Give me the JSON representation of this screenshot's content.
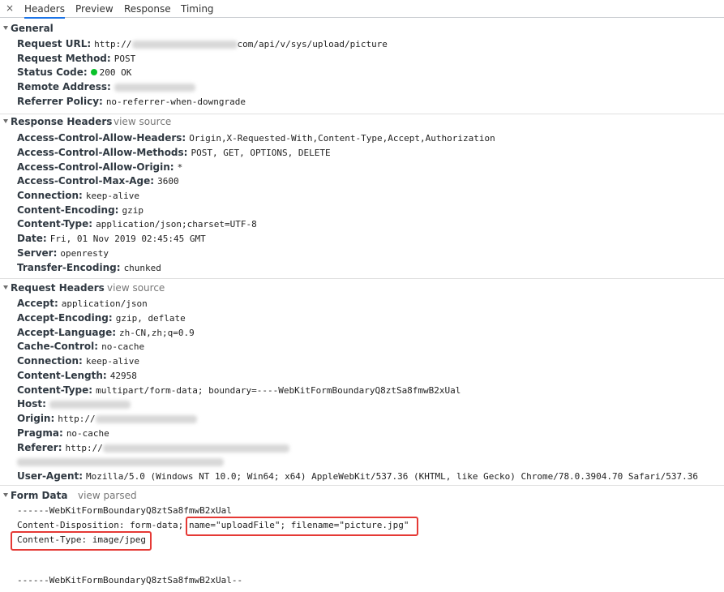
{
  "tabs": {
    "close_glyph": "×",
    "items": [
      "Headers",
      "Preview",
      "Response",
      "Timing"
    ]
  },
  "general": {
    "title": "General",
    "rows": [
      {
        "key": "Request URL:",
        "value_pre": "http://",
        "value_post": "com/api/v/sys/upload/picture"
      },
      {
        "key": "Request Method:",
        "value": "POST"
      },
      {
        "key": "Status Code:",
        "value": "200 OK",
        "status_color": "#0ac12a"
      },
      {
        "key": "Remote Address:",
        "value": ""
      },
      {
        "key": "Referrer Policy:",
        "value": "no-referrer-when-downgrade"
      }
    ]
  },
  "response_headers": {
    "title": "Response Headers",
    "view_link": "view source",
    "rows": [
      {
        "key": "Access-Control-Allow-Headers:",
        "value": "Origin,X-Requested-With,Content-Type,Accept,Authorization"
      },
      {
        "key": "Access-Control-Allow-Methods:",
        "value": "POST, GET, OPTIONS, DELETE"
      },
      {
        "key": "Access-Control-Allow-Origin:",
        "value": "*"
      },
      {
        "key": "Access-Control-Max-Age:",
        "value": "3600"
      },
      {
        "key": "Connection:",
        "value": "keep-alive"
      },
      {
        "key": "Content-Encoding:",
        "value": "gzip"
      },
      {
        "key": "Content-Type:",
        "value": "application/json;charset=UTF-8"
      },
      {
        "key": "Date:",
        "value": "Fri, 01 Nov 2019 02:45:45 GMT"
      },
      {
        "key": "Server:",
        "value": "openresty"
      },
      {
        "key": "Transfer-Encoding:",
        "value": "chunked"
      }
    ]
  },
  "request_headers": {
    "title": "Request Headers",
    "view_link": "view source",
    "rows": [
      {
        "key": "Accept:",
        "value": "application/json"
      },
      {
        "key": "Accept-Encoding:",
        "value": "gzip, deflate"
      },
      {
        "key": "Accept-Language:",
        "value": "zh-CN,zh;q=0.9"
      },
      {
        "key": "Cache-Control:",
        "value": "no-cache"
      },
      {
        "key": "Connection:",
        "value": "keep-alive"
      },
      {
        "key": "Content-Length:",
        "value": "42958"
      },
      {
        "key": "Content-Type:",
        "value": "multipart/form-data; boundary=----WebKitFormBoundaryQ8ztSa8fmwB2xUal"
      },
      {
        "key": "Host:",
        "value": ""
      },
      {
        "key": "Origin:",
        "value": "http://"
      },
      {
        "key": "Pragma:",
        "value": "no-cache"
      },
      {
        "key": "Referer:",
        "value": "http://"
      },
      {
        "key": "User-Agent:",
        "value": "Mozilla/5.0 (Windows NT 10.0; Win64; x64) AppleWebKit/537.36 (KHTML, like Gecko) Chrome/78.0.3904.70 Safari/537.36"
      }
    ]
  },
  "form_data": {
    "title": "Form Data",
    "view_link": "view parsed",
    "lines": {
      "boundary_start": "------WebKitFormBoundaryQ8ztSa8fmwB2xUal",
      "disposition_pre": "Content-Disposition: form-data;",
      "disposition_hl": "name=\"uploadFile\"; filename=\"picture.jpg\"",
      "content_type": "Content-Type: image/jpeg",
      "boundary_end": "------WebKitFormBoundaryQ8ztSa8fmwB2xUal--"
    },
    "highlight_color": "#e53935"
  }
}
